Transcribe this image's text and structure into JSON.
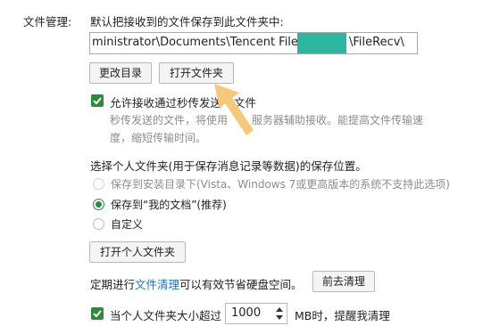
{
  "file_management": {
    "section_label": "文件管理:",
    "description": "默认把接收到的文件保存到此文件夹中:",
    "path_left": "ministrator\\Documents\\Tencent Files\\",
    "path_right": "\\FileRecv\\",
    "change_dir_button": "更改目录",
    "open_folder_button": "打开文件夹"
  },
  "second_transfer": {
    "checked": true,
    "label_a": "允许接收通过秒传发送",
    "label_b": "文件",
    "hint_line1": "秒传发送的文件，将使用",
    "hint_line1b": "服务器辅助接收。能提高文件传输速",
    "hint_line2": "度，缩短传输时间。"
  },
  "personal_folder": {
    "heading": "选择个人文件夹(用于保存消息记录等数据)的保存位置。",
    "options": [
      {
        "label": "保存到安装目录下(Vista、Windows 7或更高版本的系统不支持此选项)",
        "state": "disabled"
      },
      {
        "label": "保存到“我的文档”(推荐)",
        "state": "checked"
      },
      {
        "label": "自定义",
        "state": "unchecked"
      }
    ],
    "open_button": "打开个人文件夹"
  },
  "cleanup": {
    "text_before": "定期进行",
    "link": "文件清理",
    "text_after": "可以有效节省硬盘空间。",
    "button": "前去清理"
  },
  "size_alert": {
    "checked": true,
    "label_before": "当个人文件夹大小超过",
    "value": "1000",
    "label_after": "MB时，提醒我清理"
  },
  "colors": {
    "accent_green": "#2e8b3e",
    "link_blue": "#1a73c9",
    "redaction": "#2bb7a0",
    "arrow": "#f5c979"
  }
}
